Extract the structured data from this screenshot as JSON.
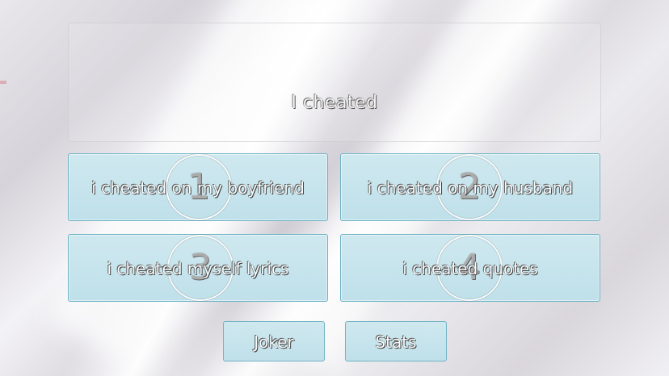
{
  "question": {
    "text": "I cheated"
  },
  "answers": [
    {
      "number": "1",
      "label": "i cheated on my boyfriend"
    },
    {
      "number": "2",
      "label": "i cheated on my husband"
    },
    {
      "number": "3",
      "label": "i cheated myself lyrics"
    },
    {
      "number": "4",
      "label": "i cheated quotes"
    }
  ],
  "lifelines": {
    "joker_label": "Joker",
    "stats_label": "Stats"
  },
  "colors": {
    "button_fill": "#c6e4ed",
    "button_border": "#6fb3c4",
    "text": "#f7fbfc"
  }
}
